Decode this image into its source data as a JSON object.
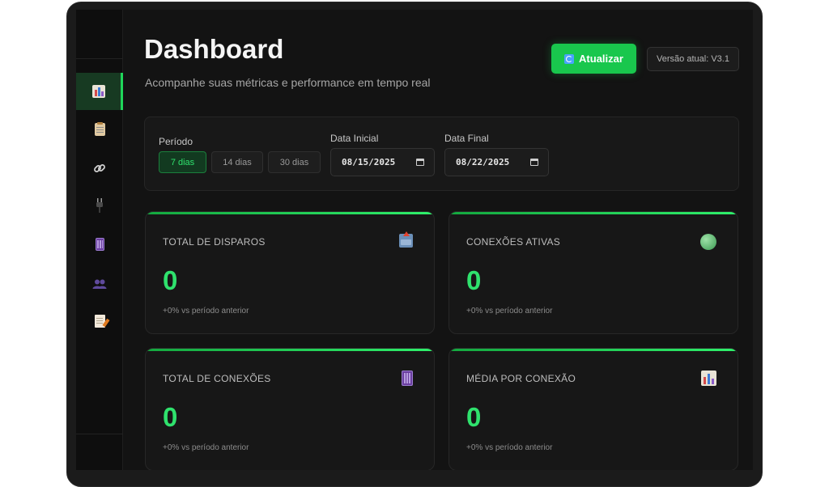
{
  "header": {
    "title": "Dashboard",
    "subtitle": "Acompanhe suas métricas e performance em tempo real",
    "refresh_label": "Atualizar",
    "version_label": "Versão atual: V3.1"
  },
  "sidebar": {
    "items": [
      {
        "icon": "bar-chart-icon",
        "active": true
      },
      {
        "icon": "clipboard-icon",
        "active": false
      },
      {
        "icon": "link-icon",
        "active": false
      },
      {
        "icon": "plug-icon",
        "active": false
      },
      {
        "icon": "phone-icon",
        "active": false
      },
      {
        "icon": "users-icon",
        "active": false
      },
      {
        "icon": "memo-icon",
        "active": false
      }
    ]
  },
  "filters": {
    "period_label": "Período",
    "period_options": [
      "7 dias",
      "14 dias",
      "30 dias"
    ],
    "period_selected": "7 dias",
    "start_label": "Data Inicial",
    "start_value": "08/15/2025",
    "end_label": "Data Final",
    "end_value": "08/22/2025"
  },
  "cards": [
    {
      "label": "TOTAL DE DISPAROS",
      "value": "0",
      "note": "+0% vs período anterior",
      "icon": "outbox-icon"
    },
    {
      "label": "CONEXÕES ATIVAS",
      "value": "0",
      "note": "+0% vs período anterior",
      "icon": "green-circle-icon"
    },
    {
      "label": "TOTAL DE CONEXÕES",
      "value": "0",
      "note": "+0% vs período anterior",
      "icon": "phone-icon"
    },
    {
      "label": "MÉDIA POR CONEXÃO",
      "value": "0",
      "note": "+0% vs período anterior",
      "icon": "bar-chart-icon"
    }
  ],
  "colors": {
    "accent": "#1fd65a",
    "background": "#131313",
    "card": "#171717"
  }
}
